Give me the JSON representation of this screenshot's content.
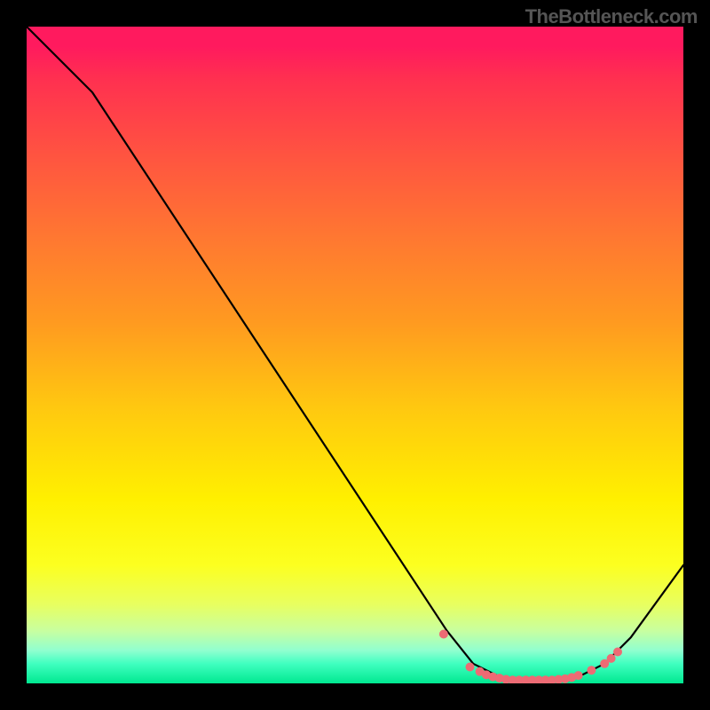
{
  "watermark": "TheBottleneck.com",
  "chart_data": {
    "type": "line",
    "title": "",
    "xlabel": "",
    "ylabel": "",
    "xlim": [
      0,
      100
    ],
    "ylim": [
      0,
      100
    ],
    "series": [
      {
        "name": "curve",
        "x": [
          0,
          10,
          64,
          68,
          72,
          74,
          82,
          84,
          88,
          90,
          92,
          100
        ],
        "values": [
          100,
          90,
          8,
          3,
          1,
          0.5,
          0.5,
          1,
          3,
          5,
          7,
          18
        ]
      }
    ],
    "markers": {
      "name": "dots",
      "x": [
        63.5,
        67.5,
        69,
        70,
        71,
        72,
        73,
        74,
        75,
        76,
        77,
        78,
        79,
        80,
        81,
        82,
        83,
        84,
        86,
        88,
        89,
        90
      ],
      "values": [
        7.5,
        2.5,
        1.8,
        1.3,
        1.0,
        0.8,
        0.6,
        0.5,
        0.5,
        0.5,
        0.5,
        0.5,
        0.5,
        0.5,
        0.6,
        0.7,
        0.9,
        1.2,
        2.0,
        3.0,
        3.8,
        4.8
      ],
      "color": "#ed6b74",
      "size": 5
    }
  }
}
